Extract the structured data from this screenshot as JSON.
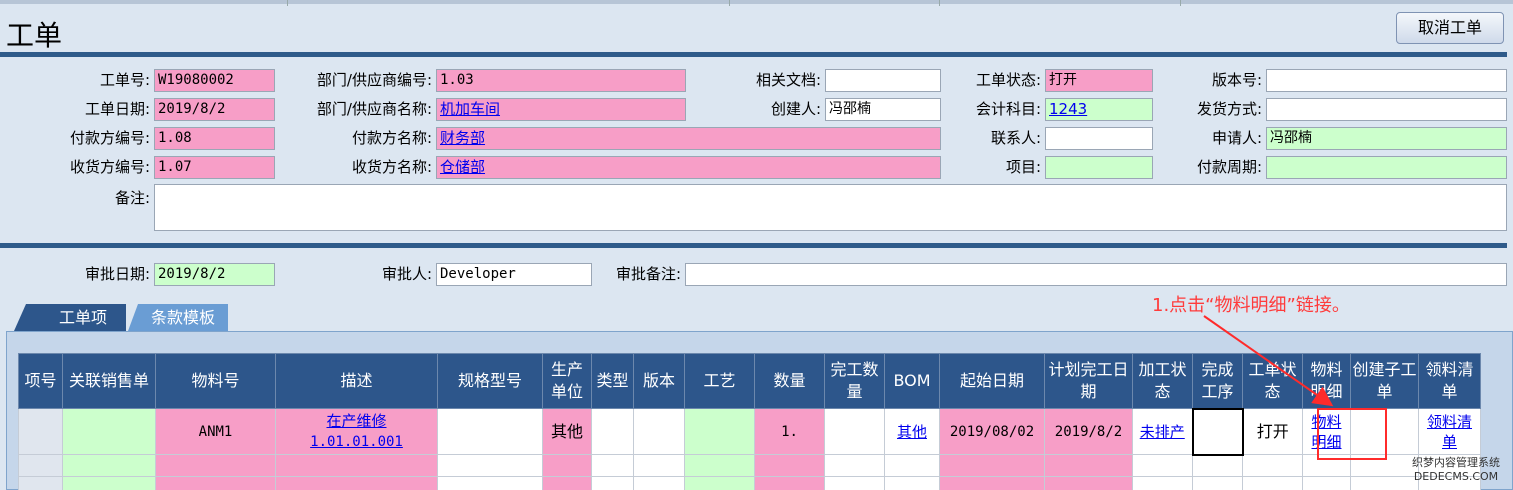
{
  "title": "工单",
  "cancel_button": "取消工单",
  "header": {
    "r1": {
      "order_no_label": "工单号:",
      "order_no": "W19080002",
      "dept_code_label": "部门/供应商编号:",
      "dept_code": "1.03",
      "doc_label": "相关文档:",
      "doc": "",
      "status_label": "工单状态:",
      "status": "打开",
      "version_label": "版本号:",
      "version": ""
    },
    "r2": {
      "date_label": "工单日期:",
      "date": "2019/8/2",
      "dept_name_label": "部门/供应商名称:",
      "dept_name": "机加车间",
      "creator_label": "创建人:",
      "creator": "冯邵楠",
      "account_label": "会计科目:",
      "account": "1243",
      "ship_label": "发货方式:",
      "ship": ""
    },
    "r3": {
      "payer_code_label": "付款方编号:",
      "payer_code": "1.08",
      "payer_name_label": "付款方名称:",
      "payer_name": "财务部",
      "contact_label": "联系人:",
      "contact": "",
      "applicant_label": "申请人:",
      "applicant": "冯邵楠"
    },
    "r4": {
      "recv_code_label": "收货方编号:",
      "recv_code": "1.07",
      "recv_name_label": "收货方名称:",
      "recv_name": "仓储部",
      "project_label": "项目:",
      "project": "",
      "period_label": "付款周期:",
      "period": ""
    },
    "remark_label": "备注:",
    "remark": ""
  },
  "approval": {
    "date_label": "审批日期:",
    "date": "2019/8/2",
    "person_label": "审批人:",
    "person": "Developer",
    "note_label": "审批备注:",
    "note": ""
  },
  "tabs": [
    "工单项",
    "条款模板"
  ],
  "annotation": "1.点击“物料明细”链接。",
  "watermark": [
    "织梦内容管理系统",
    "DEDECMS.COM"
  ],
  "table": {
    "columns": [
      "项号",
      "关联销售单",
      "物料号",
      "描述",
      "规格型号",
      "生产单位",
      "类型",
      "版本",
      "工艺",
      "数量",
      "完工数量",
      "BOM",
      "起始日期",
      "计划完工日期",
      "加工状态",
      "完成工序",
      "工单状态",
      "物料明细",
      "创建子工单",
      "领料清单"
    ],
    "rows": [
      {
        "item_no": "",
        "sales_order": "",
        "material_no": "ANM1",
        "desc_line1": "在产维修",
        "desc_line2": "1.01.01.001",
        "spec": "",
        "unit": "其他",
        "type": "",
        "version": "",
        "process": "",
        "qty": "1.",
        "done_qty": "",
        "bom": "其他",
        "start_date": "2019/08/02",
        "plan_date": "2019/8/2",
        "proc_status": "未排产",
        "done_step": "",
        "order_status": "打开",
        "detail_line1": "物料",
        "detail_line2": "明细",
        "sub_order": "",
        "pick_line1": "领料清",
        "pick_line2": "单"
      }
    ]
  },
  "colors": {
    "pink": "#f79ec7",
    "green": "#ccffcc",
    "header": "#2d568b",
    "annotation": "#ff3b3b"
  }
}
